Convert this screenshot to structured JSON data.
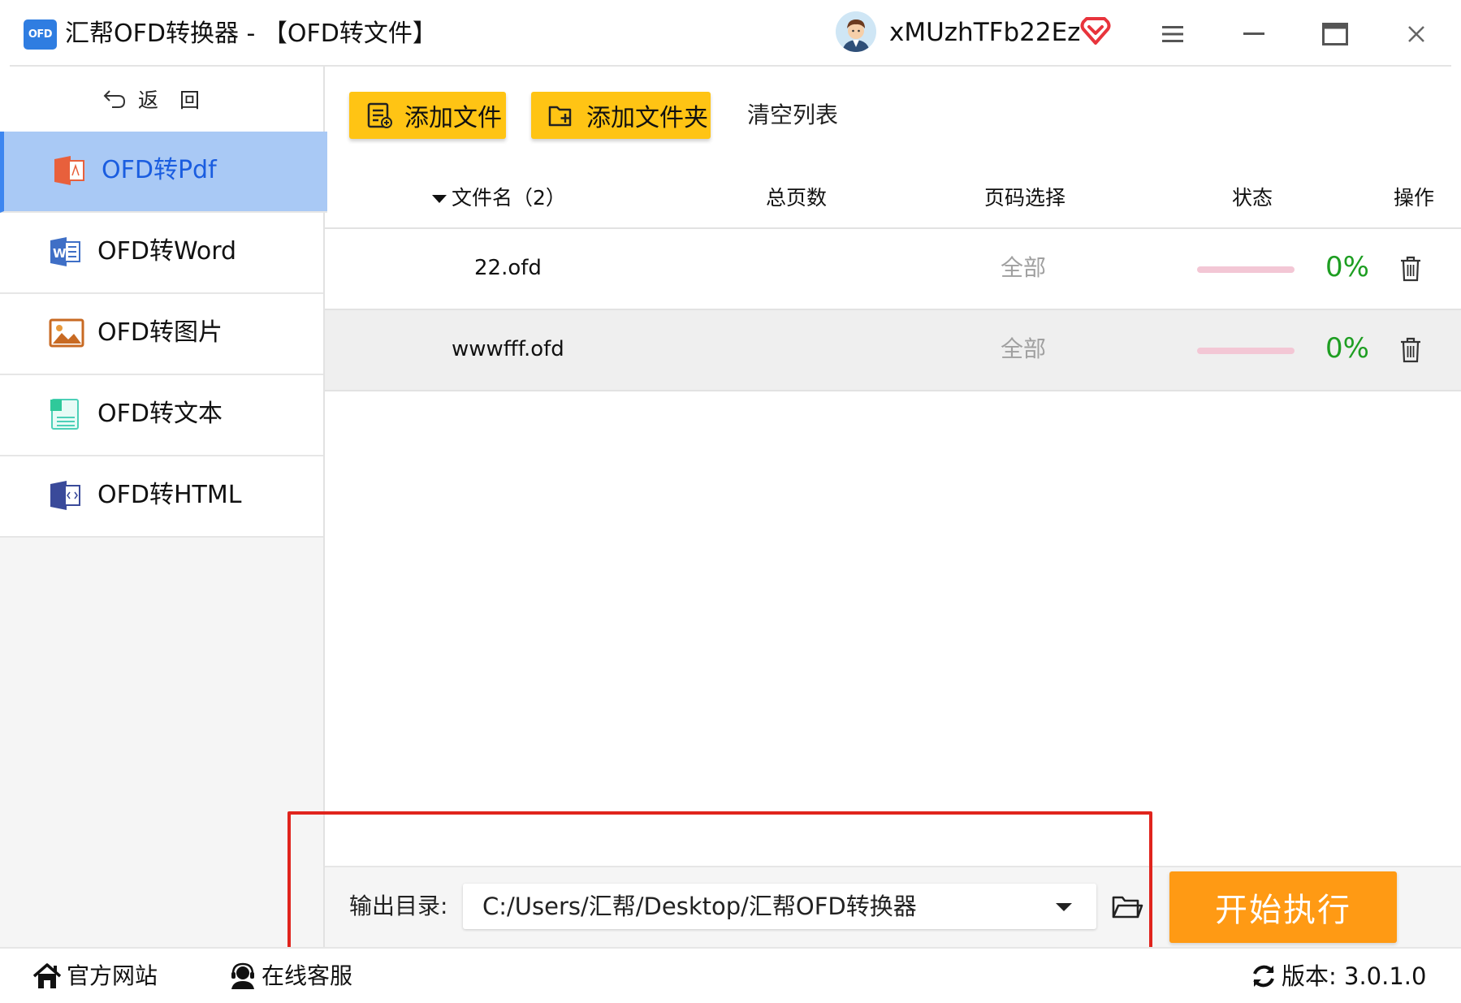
{
  "window": {
    "app_logo_text": "OFD",
    "title": "汇帮OFD转换器 - 【OFD转文件】",
    "username": "xMUzhTFb22Ez",
    "icons": [
      "avatar",
      "vip-heart-icon",
      "menu-icon",
      "minimize-icon",
      "maximize-icon",
      "close-icon"
    ]
  },
  "sidebar": {
    "back_label": "返回",
    "items": [
      {
        "label": "OFD转Pdf",
        "icon": "pdf-file-icon",
        "active": true
      },
      {
        "label": "OFD转Word",
        "icon": "word-file-icon",
        "active": false
      },
      {
        "label": "OFD转图片",
        "icon": "image-file-icon",
        "active": false
      },
      {
        "label": "OFD转文本",
        "icon": "text-file-icon",
        "active": false
      },
      {
        "label": "OFD转HTML",
        "icon": "html-file-icon",
        "active": false
      }
    ]
  },
  "toolbar": {
    "add_file": "添加文件",
    "add_folder": "添加文件夹",
    "clear_list": "清空列表"
  },
  "table": {
    "headers": {
      "filename": "文件名（2）",
      "total_pages": "总页数",
      "page_select": "页码选择",
      "status": "状态",
      "action": "操作"
    },
    "rows": [
      {
        "filename": "22.ofd",
        "total_pages": "",
        "page_select": "全部",
        "progress": 0,
        "progress_text": "0%"
      },
      {
        "filename": "wwwfff.ofd",
        "total_pages": "",
        "page_select": "全部",
        "progress": 0,
        "progress_text": "0%"
      }
    ]
  },
  "output": {
    "label": "输出目录:",
    "path": "C:/Users/汇帮/Desktop/汇帮OFD转换器"
  },
  "start_button": "开始执行",
  "statusbar": {
    "website": "官方网站",
    "support": "在线客服",
    "version": "版本:  3.0.1.0"
  },
  "colors": {
    "accent_yellow": "#ffc414",
    "start_orange": "#ff9a14",
    "active_nav_bg": "#a9c9f5",
    "active_nav_text": "#1a5de0",
    "progress_text": "#1e9e22",
    "progress_track": "#f3c7d5",
    "highlight_red": "#e0241d"
  }
}
